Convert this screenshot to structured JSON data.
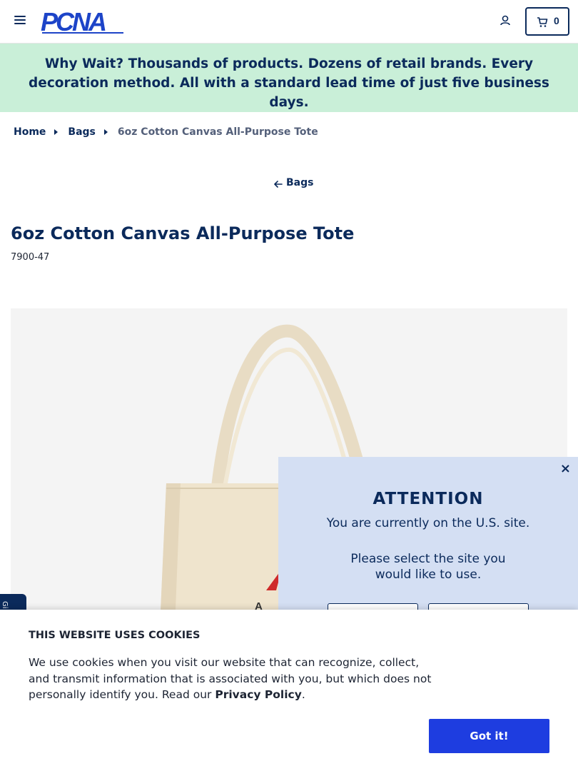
{
  "header": {
    "menu_icon": "hamburger-menu-icon",
    "logo_text": "PCNA",
    "account_icon": "user-icon",
    "cart_icon": "cart-icon",
    "cart_count": "0"
  },
  "promo": {
    "lead": "Why Wait?",
    "text": " Thousands of products. Dozens of retail brands. Every decoration method. All with a standard lead time of just five business days."
  },
  "breadcrumb": {
    "items": [
      "Home",
      "Bags"
    ],
    "current": "6oz Cotton Canvas All-Purpose Tote"
  },
  "back_link": {
    "label": "Bags",
    "icon": "arrow-left-icon"
  },
  "product": {
    "title": "6oz Cotton Canvas All-Purpose Tote",
    "sku": "7900-47"
  },
  "attention_modal": {
    "title": "ATTENTION",
    "line1": "You are currently on the U.S. site.",
    "line2": "Please select the site you would like to use.",
    "close_label": "×"
  },
  "cookie_banner": {
    "title": "THIS WEBSITE USES COOKIES",
    "text": "We use cookies when you visit our website that can recognize, collect, and transmit information that is associated with you, but which does not personally identify you. Read our ",
    "link_label": "Privacy Policy",
    "text_end": ".",
    "button_label": "Got it!"
  },
  "colors": {
    "brand_navy": "#0b2a5b",
    "promo_bg": "#c9efd8",
    "modal_bg": "#d4dff3",
    "button_blue": "#1e3de0"
  }
}
